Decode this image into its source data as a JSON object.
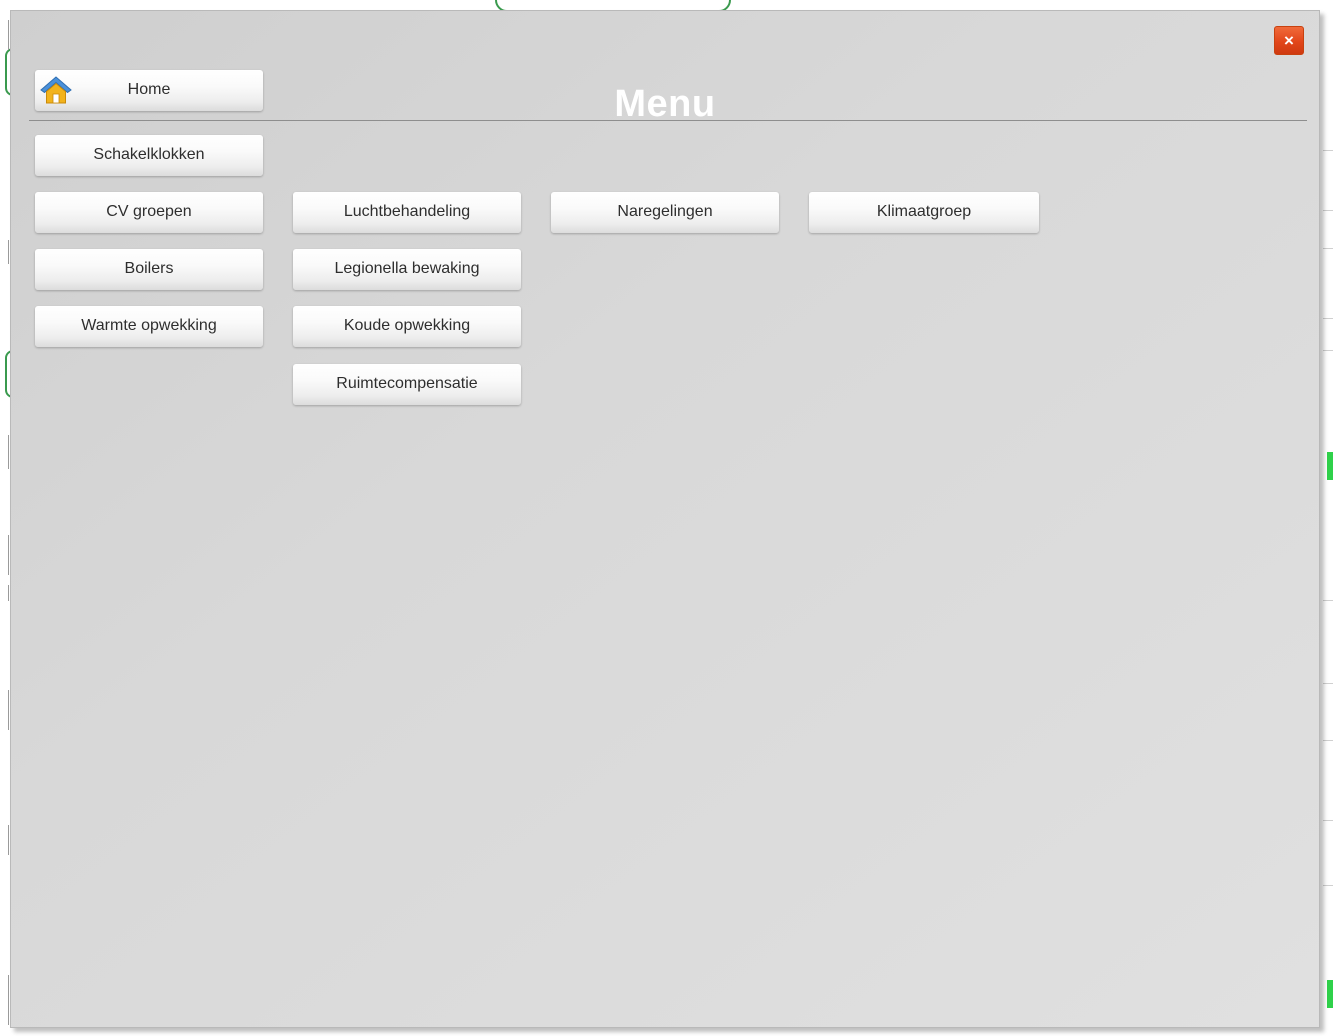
{
  "modal": {
    "title": "Menu",
    "close_label": "×"
  },
  "menu": {
    "home": "Home",
    "schakelklokken": "Schakelklokken",
    "cv_groepen": "CV groepen",
    "boilers": "Boilers",
    "warmte_opwekking": "Warmte opwekking",
    "luchtbehandeling": "Luchtbehandeling",
    "legionella_bewaking": "Legionella bewaking",
    "koude_opwekking": "Koude opwekking",
    "ruimtecompensatie": "Ruimtecompensatie",
    "naregelingen": "Naregelingen",
    "klimaatgroep": "Klimaatgroep"
  },
  "icons": {
    "home": "home-icon",
    "close": "close-icon"
  },
  "colors": {
    "close_button": "#e2461a",
    "home_icon_roof": "#4a90d9",
    "home_icon_body": "#f2b31c",
    "background_accent": "#3a9a4e"
  }
}
